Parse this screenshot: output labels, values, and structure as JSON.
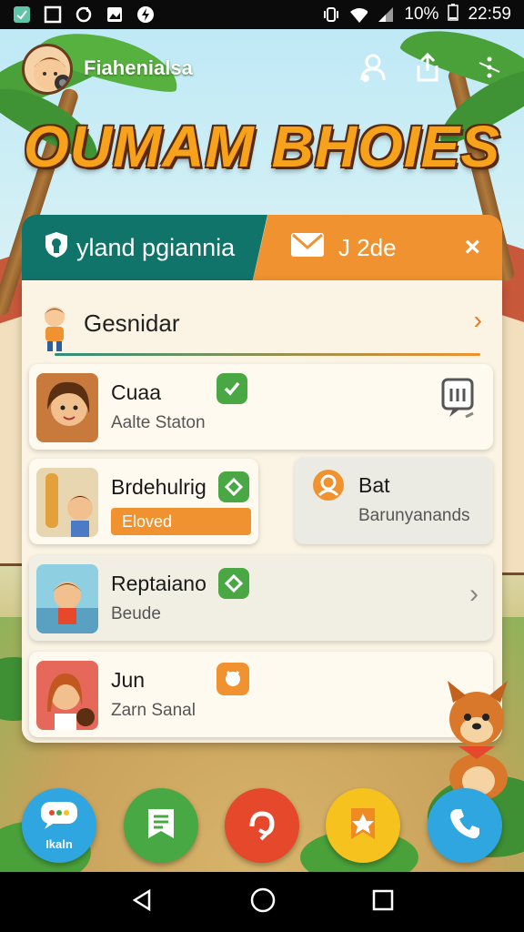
{
  "status_bar": {
    "battery": "10%",
    "time": "22:59",
    "left_icons": [
      "app-icon",
      "square-icon",
      "sync-icon",
      "image-icon",
      "bolt-icon"
    ],
    "right_icons": [
      "vibrate-icon",
      "wifi-icon",
      "signal-icon"
    ]
  },
  "header": {
    "username": "Fiahenialsa",
    "actions": [
      "friends-icon",
      "share-icon",
      "menu-icon"
    ]
  },
  "logo_text": "OUMAM BHOIES",
  "tabs": {
    "left_label": "yland pgiannia",
    "right_label": "J 2de",
    "close": "×"
  },
  "section": {
    "title": "Gesnidar",
    "chevron": "›"
  },
  "cards": [
    {
      "name": "Cuaa",
      "subtitle": "Aalte Staton"
    },
    {
      "name": "Brdehulrig",
      "action": "Eloved"
    },
    {
      "name": "Bat",
      "subtitle": "Barunyanands"
    },
    {
      "name": "Reptaiano",
      "subtitle": "Beude",
      "chevron": "›"
    },
    {
      "name": "Jun",
      "subtitle": "Zarn Sanal"
    }
  ],
  "bottom_actions": [
    {
      "icon": "chat-icon",
      "label": "Ikaln",
      "color": "#2fa6df"
    },
    {
      "icon": "document-icon",
      "label": "",
      "color": "#48a843"
    },
    {
      "icon": "refresh-icon",
      "label": "",
      "color": "#e5482a"
    },
    {
      "icon": "badge-icon",
      "label": "",
      "color": "#f6c21e"
    },
    {
      "icon": "phone-icon",
      "label": "",
      "color": "#2fa6df"
    }
  ],
  "nav": [
    "back-icon",
    "home-icon",
    "recents-icon"
  ],
  "colors": {
    "teal": "#11746a",
    "orange": "#f0922f",
    "green": "#49a843",
    "panel": "#fbf4e4"
  }
}
